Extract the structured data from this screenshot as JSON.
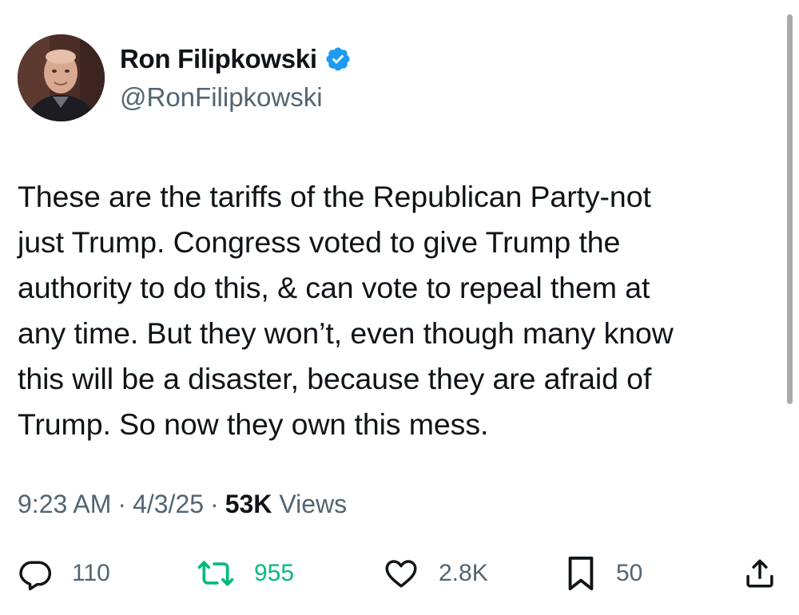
{
  "author": {
    "display_name": "Ron Filipkowski",
    "handle": "@RonFilipkowski",
    "verified": true,
    "verified_color": "#1d9bf0"
  },
  "tweet": {
    "text": "These are the tariffs of the Republican Party-not\njust Trump. Congress voted to give Trump the\nauthority to do this, & can vote to repeal them at\nany time. But they won’t, even though many know\nthis will be a disaster, because they are afraid of\nTrump. So now they own this mess."
  },
  "meta": {
    "time": "9:23 AM",
    "separator": "·",
    "date": "4/3/25",
    "views_count": "53K",
    "views_label": "Views"
  },
  "actions": {
    "reply": {
      "icon": "reply-icon",
      "count": "110"
    },
    "retweet": {
      "icon": "retweet-icon",
      "count": "955",
      "color": "#00ba7c"
    },
    "like": {
      "icon": "heart-icon",
      "count": "2.8K"
    },
    "bookmark": {
      "icon": "bookmark-icon",
      "count": "50"
    },
    "share": {
      "icon": "share-icon"
    }
  },
  "colors": {
    "text_primary": "#0f1419",
    "text_secondary": "#536471",
    "accent_blue": "#1d9bf0",
    "retweet_green": "#00ba7c"
  }
}
